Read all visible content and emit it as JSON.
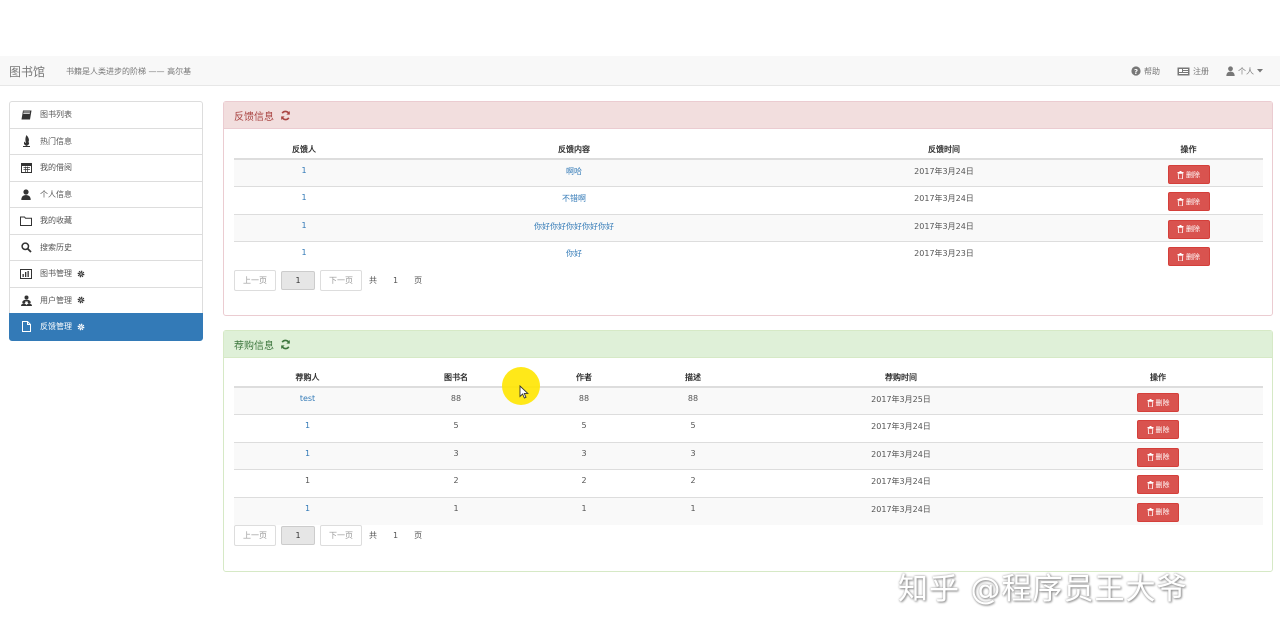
{
  "header": {
    "brand": "图书馆",
    "motto": "书籍是人类进步的阶梯 —— 高尔基",
    "nav": [
      {
        "label": "帮助",
        "icon": "question-circle-icon"
      },
      {
        "label": "注册",
        "icon": "id-card-icon"
      },
      {
        "label": "个人",
        "icon": "user-icon"
      }
    ]
  },
  "sidebar": {
    "items": [
      {
        "label": "图书列表",
        "icon": "book-icon"
      },
      {
        "label": "热门信息",
        "icon": "fire-icon"
      },
      {
        "label": "我的借阅",
        "icon": "calendar-icon"
      },
      {
        "label": "个人信息",
        "icon": "user-icon"
      },
      {
        "label": "我的收藏",
        "icon": "folder-icon"
      },
      {
        "label": "搜索历史",
        "icon": "search-icon"
      },
      {
        "label": "图书管理",
        "icon": "bar-chart-icon"
      },
      {
        "label": "用户管理",
        "icon": "users-icon"
      },
      {
        "label": "反馈管理",
        "icon": "file-icon",
        "active": true
      }
    ]
  },
  "feedback": {
    "title": "反馈信息",
    "headers": [
      "反馈人",
      "反馈内容",
      "反馈时间",
      "操作"
    ],
    "rows": [
      {
        "user": "1",
        "content": "啊哈",
        "time": "2017年3月24日"
      },
      {
        "user": "1",
        "content": "不错啊",
        "time": "2017年3月24日"
      },
      {
        "user": "1",
        "content": "你好你好你好你好你好",
        "time": "2017年3月24日"
      },
      {
        "user": "1",
        "content": "你好",
        "time": "2017年3月23日"
      }
    ],
    "delete_label": "删除",
    "pager": {
      "prev": "上一页",
      "current": "1",
      "next": "下一页",
      "total_prefix": "共",
      "total": "1",
      "total_suffix": "页"
    }
  },
  "recommend": {
    "title": "荐购信息",
    "headers": [
      "荐购人",
      "图书名",
      "作者",
      "描述",
      "荐购时间",
      "操作"
    ],
    "rows": [
      {
        "user": "test",
        "book": "88",
        "author": "88",
        "desc": "88",
        "time": "2017年3月25日"
      },
      {
        "user": "1",
        "book": "5",
        "author": "5",
        "desc": "5",
        "time": "2017年3月24日"
      },
      {
        "user": "1",
        "book": "3",
        "author": "3",
        "desc": "3",
        "time": "2017年3月24日"
      },
      {
        "user": "1",
        "book": "2",
        "author": "2",
        "desc": "2",
        "time": "2017年3月24日"
      },
      {
        "user": "1",
        "book": "1",
        "author": "1",
        "desc": "1",
        "time": "2017年3月24日"
      }
    ],
    "delete_label": "删除",
    "pager": {
      "prev": "上一页",
      "current": "1",
      "next": "下一页",
      "total_prefix": "共",
      "total": "1",
      "total_suffix": "页"
    }
  },
  "watermark": "知乎 @程序员王大爷",
  "colors": {
    "primary": "#337ab7",
    "danger": "#d9534f",
    "danger_panel": "#f2dede",
    "success_panel": "#dff0d8"
  }
}
